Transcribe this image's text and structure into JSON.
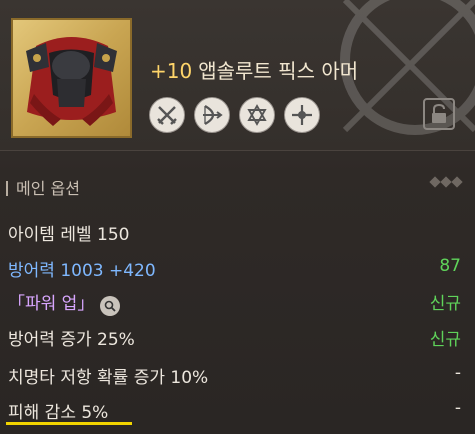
{
  "item": {
    "enhance": "+10",
    "name": "앱솔루트 픽스 아머",
    "class_icons": [
      "crossed-swords-icon",
      "bow-icon",
      "star-of-david-icon",
      "compass-cross-icon"
    ],
    "lock_icon": "unlock-icon"
  },
  "main_options": {
    "title": "메인 옵션",
    "rows": [
      {
        "label": "아이템 레벨 150",
        "value": ""
      },
      {
        "label": "방어력 1003 +420",
        "value": "87"
      },
      {
        "label": "「파워 업」",
        "value": "신규"
      },
      {
        "label": "방어력 증가 25%",
        "value": "신규"
      },
      {
        "label": "치명타 저항 확률 증가 10%",
        "value": "-"
      },
      {
        "label": "피해 감소 5%",
        "value": "-"
      }
    ]
  },
  "colors": {
    "enhance": "#ffd56a",
    "stat_blue": "#7fb8ff",
    "stat_green": "#5fd35a",
    "highlight_underline": "#f2d400"
  }
}
